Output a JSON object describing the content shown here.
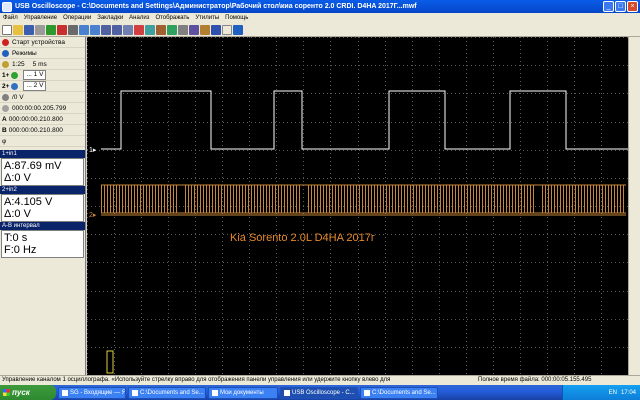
{
  "window": {
    "title": "USB Oscilloscope - C:\\Documents and Settings\\Администратор\\Рабочий стол\\киа соренто 2.0 CRDI. D4HA 2017Г...mwf"
  },
  "menu": [
    "Файл",
    "Управление",
    "Операции",
    "Закладки",
    "Анализ",
    "Отображать",
    "Утилиты",
    "Помощь"
  ],
  "left_panel": {
    "start_device": "Старт устройства",
    "modes": "Режимы",
    "sample_rate": "1:25",
    "time_div": "5 ms",
    "ch1_label": "1+",
    "ch1_volts": "... 1 V",
    "ch2_label": "2+",
    "ch2_volts": "... 2 V",
    "trigger": "/0 V",
    "cursor_t": "000:00:00.205.799",
    "cursor_a_label": "A",
    "cursor_a": "000:00:00.210.800",
    "cursor_b_label": "B",
    "cursor_b": "000:00:00.210.800",
    "phi": "φ",
    "ch1_head": "1+in1",
    "ch1_a": "A:87.69 mV",
    "ch1_d": "Δ:0 V",
    "ch2_head": "2+in2",
    "ch2_a": "A:4.105 V",
    "ch2_d": "Δ:0 V",
    "ab_head": "A-B интервал",
    "ab_t": "T:0 s",
    "ab_f": "F:0 Hz"
  },
  "scope": {
    "annotation": "Kia Sorento  2.0L D4HA 2017г",
    "ch1_marker": "1▸",
    "ch2_marker": "2▸",
    "ch1_color": "#ffffff",
    "ch2_color": "#c9873a",
    "annotation_color": "#e58a2a",
    "grid": true
  },
  "status": {
    "left": "Управление каналом 1 осциллографа. «Используйте стрелку вправо для отображения панели управления или удержите кнопку влево для",
    "right": "Полное время файла: 000:00:05.155.495"
  },
  "taskbar": {
    "start": "пуск",
    "tasks": [
      "SG - Входящие — Ян...",
      "C:\\Documents and Se...",
      "Мои документы",
      "USB Oscilloscope - C...",
      "C:\\Documents and Se..."
    ],
    "active_index": 3,
    "lang": "EN",
    "clock": "17:04"
  }
}
